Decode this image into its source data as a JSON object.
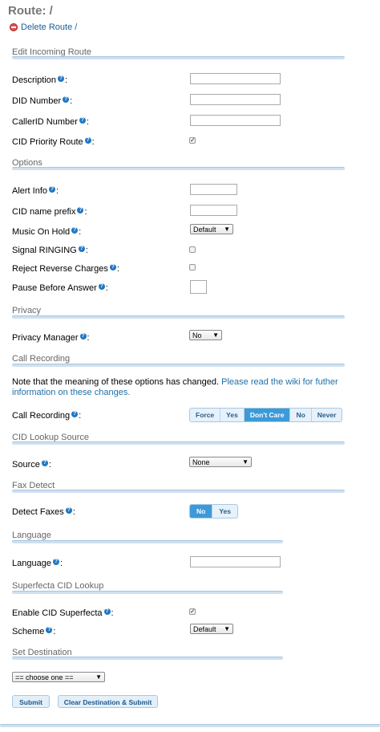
{
  "header": {
    "title": "Route: /",
    "delete_label": "Delete Route /"
  },
  "sections": {
    "edit": "Edit Incoming Route",
    "options": "Options",
    "privacy": "Privacy",
    "call_recording": "Call Recording",
    "cid_lookup": "CID Lookup Source",
    "fax": "Fax Detect",
    "language": "Language",
    "superfecta": "Superfecta CID Lookup",
    "destination": "Set Destination"
  },
  "fields": {
    "description": "Description",
    "did_number": "DID Number",
    "callerid_number": "CallerID Number",
    "cid_priority": "CID Priority Route",
    "alert_info": "Alert Info",
    "cid_name_prefix": "CID name prefix",
    "music_on_hold": "Music On Hold",
    "signal_ringing": "Signal RINGING",
    "reject_reverse": "Reject Reverse Charges",
    "pause_before_answer": "Pause Before Answer",
    "privacy_manager": "Privacy Manager",
    "call_recording": "Call Recording",
    "source": "Source",
    "detect_faxes": "Detect Faxes",
    "language": "Language",
    "enable_superfecta": "Enable CID Superfecta",
    "scheme": "Scheme"
  },
  "values": {
    "music_on_hold": "Default",
    "privacy_manager": "No",
    "source": "None",
    "scheme": "Default",
    "destination": "== choose one =="
  },
  "checkboxes": {
    "cid_priority": true,
    "signal_ringing": false,
    "reject_reverse": false,
    "enable_superfecta": true
  },
  "recording_note": {
    "text": "Note that the meaning of these options has changed.",
    "link": "Please read the wiki for futher information on these changes."
  },
  "recording_options": [
    "Force",
    "Yes",
    "Don't Care",
    "No",
    "Never"
  ],
  "recording_selected": "Don't Care",
  "fax_options": [
    "No",
    "Yes"
  ],
  "fax_selected": "No",
  "buttons": {
    "submit": "Submit",
    "clear_submit": "Clear Destination & Submit"
  },
  "colors": {
    "accent": "#3d9ad8",
    "link": "#1f6fa7",
    "delete": "#d9534f"
  }
}
